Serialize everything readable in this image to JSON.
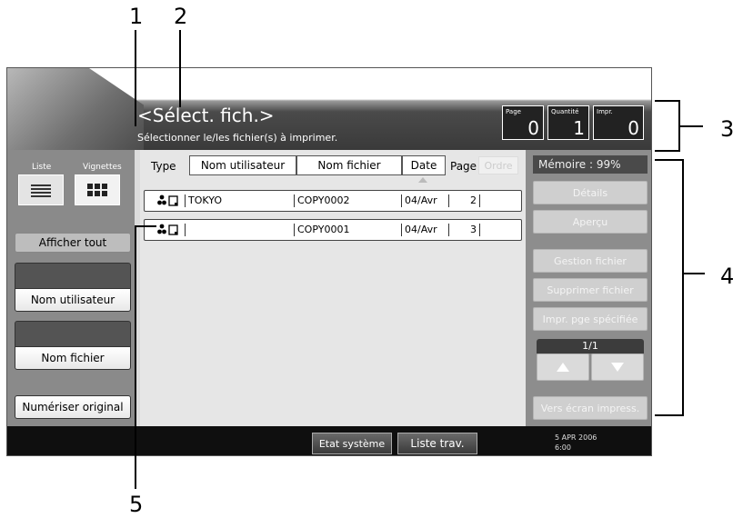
{
  "callouts": [
    "1",
    "2",
    "3",
    "4",
    "5"
  ],
  "header": {
    "title": "<Sélect. fich.>",
    "subtitle": "Sélectionner le/les fichier(s) à imprimer."
  },
  "counters": [
    {
      "label": "Page",
      "value": "0"
    },
    {
      "label": "Quantité",
      "value": "1"
    },
    {
      "label": "Impr.",
      "value": "0"
    }
  ],
  "left": {
    "tab_list": "Liste",
    "tab_thumbs": "Vignettes",
    "show_all": "Afficher tout",
    "user_name": "Nom utilisateur",
    "file_name": "Nom fichier",
    "scan_original": "Numériser original"
  },
  "columns": {
    "type": "Type",
    "user": "Nom utilisateur",
    "file": "Nom fichier",
    "date": "Date",
    "page": "Page",
    "order": "Ordre"
  },
  "rows": [
    {
      "user": "TOKYO",
      "file": "COPY0002",
      "date": "04/Avr",
      "pages": "2"
    },
    {
      "user": "",
      "file": "COPY0001",
      "date": "04/Avr",
      "pages": "3"
    }
  ],
  "right": {
    "memory": "Mémoire :  99%",
    "details": "Détails",
    "preview": "Aperçu",
    "file_mgmt": "Gestion fichier",
    "delete_file": "Supprimer fichier",
    "print_page": "Impr. pge spécifiée",
    "page_indicator": "1/1",
    "to_print_screen": "Vers écran impress."
  },
  "footer": {
    "system_status": "Etat système",
    "job_list": "Liste trav.",
    "date": "5 APR  2006",
    "time": "6:00"
  }
}
